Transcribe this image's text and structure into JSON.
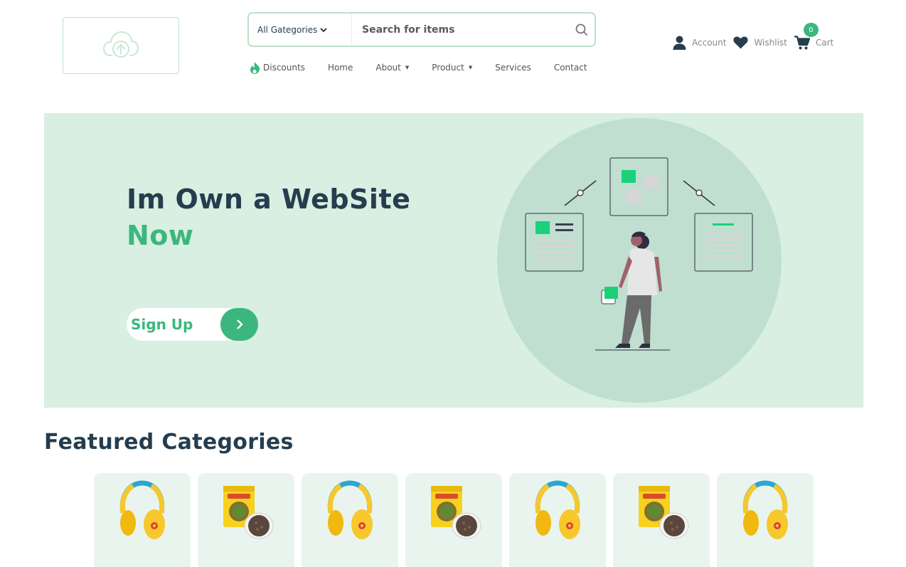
{
  "search": {
    "category_label": "All Gategories",
    "placeholder": "Search for items"
  },
  "nav": {
    "items": [
      {
        "label": "Discounts",
        "icon": "fire-icon"
      },
      {
        "label": "Home"
      },
      {
        "label": "About",
        "dropdown": true
      },
      {
        "label": "Product",
        "dropdown": true
      },
      {
        "label": "Services"
      },
      {
        "label": "Contact"
      }
    ]
  },
  "header_actions": {
    "account": "Account",
    "wishlist": "Wishlist",
    "cart": "Cart",
    "cart_count": "0"
  },
  "hero": {
    "title_line1": "Im Own a WebSite",
    "title_line2": "Now",
    "signup_label": "Sign Up"
  },
  "featured": {
    "title": "Featured Categories",
    "items": [
      {
        "image": "headphones-icon"
      },
      {
        "image": "food-bag-icon"
      },
      {
        "image": "headphones-icon"
      },
      {
        "image": "food-bag-icon"
      },
      {
        "image": "headphones-icon"
      },
      {
        "image": "food-bag-icon"
      },
      {
        "image": "headphones-icon"
      }
    ]
  },
  "colors": {
    "brand": "#3bb77e",
    "heading": "#253d4e",
    "hero_bg": "#d8efe1",
    "card_bg": "#eaf4ee"
  }
}
